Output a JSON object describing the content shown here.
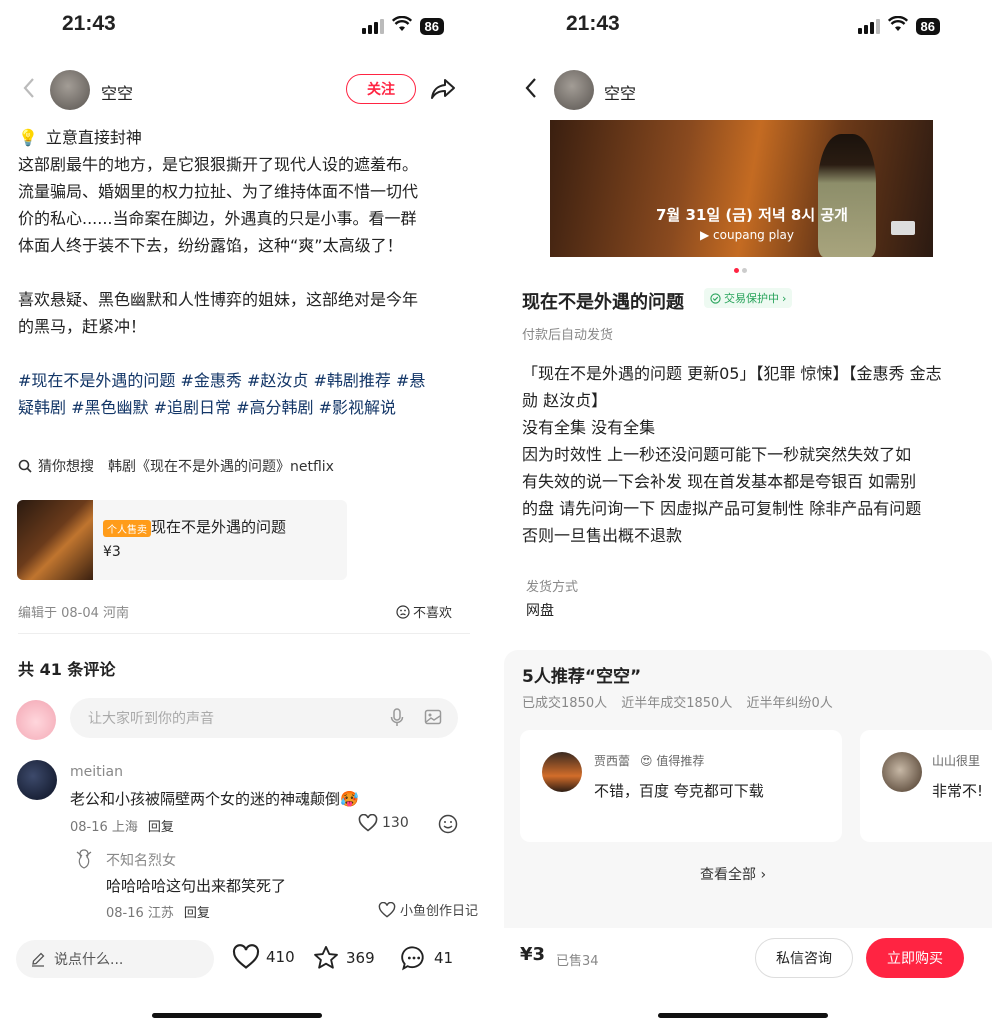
{
  "left": {
    "status": {
      "time": "21:43",
      "battery": "86"
    },
    "author": {
      "name": "空空",
      "follow_label": "关注"
    },
    "post": {
      "title": "立意直接封神",
      "paragraph1_lines": [
        "这部剧最牛的地方，是它狠狠撕开了现代人设的遮羞布。",
        "流量骗局、婚姻里的权力拉扯、为了维持体面不惜一切代",
        "价的私心......当命案在脚边，外遇真的只是小事。看一群",
        "体面人终于装不下去，纷纷露馅，这种“爽”太高级了！"
      ],
      "paragraph2_lines": [
        "喜欢悬疑、黑色幽默和人性博弈的姐妹，这部绝对是今年",
        "的黑马，赶紧冲！"
      ],
      "tag_lines": [
        "#现在不是外遇的问题 #金惠秀 #赵汝贞 #韩剧推荐 #悬",
        "疑韩剧 #黑色幽默 #追剧日常 #高分韩剧 #影视解说"
      ]
    },
    "guess": {
      "label": "猜你想搜",
      "query": "韩剧《现在不是外遇的问题》netflix"
    },
    "product": {
      "badge": "个人售卖",
      "name": "现在不是外遇的问题",
      "price": "¥3"
    },
    "meta": {
      "edited": "编辑于 08-04 河南",
      "dislike": "不喜欢"
    },
    "comments_title": "共 41 条评论",
    "comment_input_placeholder": "让大家听到你的声音",
    "comments": [
      {
        "user": "meitian",
        "text": "老公和小孩被隔壁两个女的迷的神魂颠倒🥵",
        "date": "08-16 上海",
        "reply": "回复",
        "likes": "130"
      }
    ],
    "reply": {
      "user": "不知名烈女",
      "text": "哈哈哈哈这句出来都笑死了",
      "date": "08-16 江苏",
      "reply": "回复",
      "overlay": "小鱼创作日记"
    },
    "bottom": {
      "say": "说点什么...",
      "likes": "410",
      "stars": "369",
      "comments": "41"
    }
  },
  "right": {
    "status": {
      "time": "21:43",
      "battery": "86"
    },
    "author": {
      "name": "空空"
    },
    "banner": {
      "date": "7월 31일 (금) 저녁 8시 공개",
      "brand": "coupang play"
    },
    "title": "现在不是外遇的问题",
    "protection": "交易保护中",
    "auto_ship": "付款后自动发货",
    "desc_lines": [
      "「现在不是外遇的问题 更新05」【犯罪 惊悚】【金惠秀 金志",
      "勋 赵汝贞】",
      "没有全集 没有全集",
      "因为时效性 上一秒还没问题可能下一秒就突然失效了如",
      "有失效的说一下会补发 现在首发基本都是夸银百 如需别",
      "的盘 请先问询一下 因虚拟产品可复制性 除非产品有问题",
      "否则一旦售出概不退款"
    ],
    "ship": {
      "label": "发货方式",
      "value": "网盘"
    },
    "recommend": {
      "title": "5人推荐“空空”",
      "stats": [
        "已成交1850人",
        "近半年成交1850人",
        "近半年纠纷0人"
      ],
      "cards": [
        {
          "user": "贾西蕾",
          "tag": "😍 值得推荐",
          "text": "不错，百度 夸克都可下载"
        },
        {
          "user": "山山很里",
          "tag": "",
          "text": "非常不!"
        }
      ],
      "see_all": "查看全部"
    },
    "bottom": {
      "price": "¥3",
      "sold": "已售34",
      "msg": "私信咨询",
      "buy": "立即购买"
    }
  },
  "colors": {
    "accent": "#ff2442",
    "tag": "#133667",
    "protect": "#27a35a"
  }
}
